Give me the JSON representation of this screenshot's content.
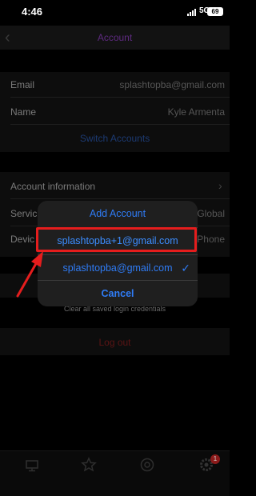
{
  "status_bar": {
    "time": "4:46",
    "network": "5G",
    "battery": "69"
  },
  "nav": {
    "title": "Account"
  },
  "account": {
    "email_label": "Email",
    "email_value": "splashtopba@gmail.com",
    "name_label": "Name",
    "name_value": "Kyle Armenta",
    "switch_accounts": "Switch Accounts"
  },
  "settings": {
    "account_information": "Account information",
    "service_label": "Servic",
    "service_value": "Global",
    "device_label": "Devic",
    "device_value": "Phone"
  },
  "note": "Clear all saved login credentials",
  "logout": "Log out",
  "sheet": {
    "title": "Add Account",
    "option_1": "splashtopba+1@gmail.com",
    "option_2": "splashtopba@gmail.com",
    "cancel": "Cancel"
  },
  "tabbar": {
    "badge": "1"
  },
  "colors": {
    "sheet_text": "#2f7cf6",
    "highlight_box": "#e51d1d",
    "logout": "#5a1414"
  }
}
